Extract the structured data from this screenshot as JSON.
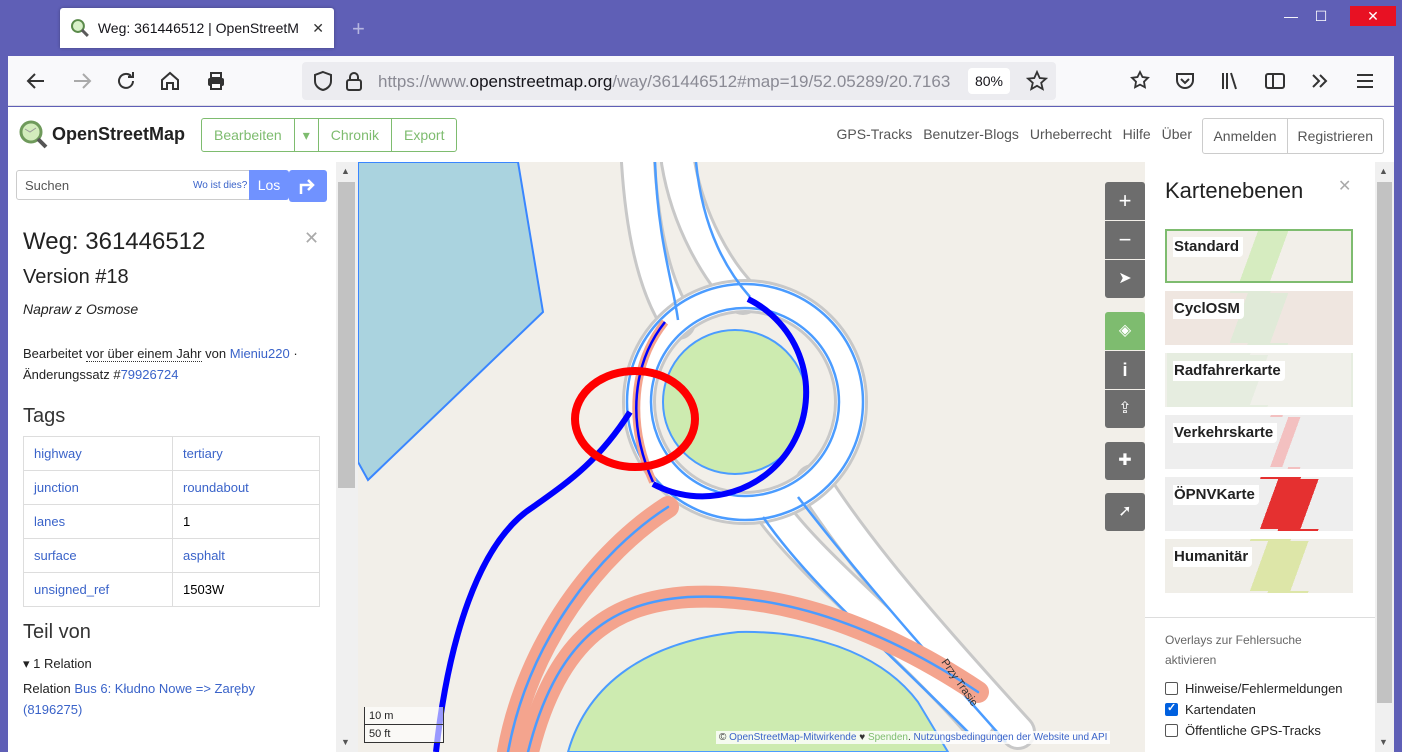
{
  "browser": {
    "tab_title": "Weg: 361446512 | OpenStreetM",
    "url_prefix": "https://www.",
    "url_domain": "openstreetmap.org",
    "url_rest": "/way/361446512#map=19/52.05289/20.7163",
    "zoom": "80%"
  },
  "header": {
    "brand": "OpenStreetMap",
    "edit": "Bearbeiten",
    "history": "Chronik",
    "export": "Export",
    "links": [
      "GPS-Tracks",
      "Benutzer-Blogs",
      "Urheberrecht",
      "Hilfe",
      "Über"
    ],
    "login": "Anmelden",
    "signup": "Registrieren"
  },
  "search": {
    "placeholder": "Suchen",
    "where": "Wo ist dies?",
    "go": "Los"
  },
  "way": {
    "title": "Weg: 361446512",
    "version": "Version #18",
    "comment": "Napraw z Osmose",
    "edited_prefix": "Bearbeitet",
    "edited_when": "vor über einem Jahr",
    "edited_by": "von",
    "user": "Mieniu220",
    "changeset_label": "Änderungssatz #",
    "changeset": "79926724",
    "tags_heading": "Tags",
    "tags": [
      {
        "k": "highway",
        "v": "tertiary",
        "vlink": true
      },
      {
        "k": "junction",
        "v": "roundabout",
        "vlink": true
      },
      {
        "k": "lanes",
        "v": "1",
        "vlink": false
      },
      {
        "k": "surface",
        "v": "asphalt",
        "vlink": true
      },
      {
        "k": "unsigned_ref",
        "v": "1503W",
        "vlink": false
      }
    ],
    "partof_heading": "Teil von",
    "relation_count": "▾ 1 Relation",
    "relation_prefix": "Relation",
    "relation_name": "Bus 6: Kłudno Nowe => Zaręby",
    "relation_id": "(8196275)"
  },
  "map": {
    "road_label": "Przy Trasie",
    "scale_m": "10 m",
    "scale_ft": "50 ft",
    "attribution": {
      "copy": "©",
      "contributors": "OpenStreetMap-Mitwirkende",
      "heart": "♥",
      "donate": "Spenden",
      "terms": "Nutzungsbedingungen der Website und API"
    }
  },
  "layers": {
    "title": "Kartenebenen",
    "items": [
      "Standard",
      "CyclOSM",
      "Radfahrerkarte",
      "Verkehrskarte",
      "ÖPNVKarte",
      "Humanitär"
    ],
    "overlays_heading": "Overlays zur Fehlersuche aktivieren",
    "overlays": [
      {
        "label": "Hinweise/Fehlermeldungen",
        "checked": false
      },
      {
        "label": "Kartendaten",
        "checked": true
      },
      {
        "label": "Öffentliche GPS-Tracks",
        "checked": false
      }
    ]
  },
  "colors": {
    "osm_green": "#7ebc6f",
    "highlight_blue": "#0000ff",
    "annotation_red": "#ff0000"
  }
}
